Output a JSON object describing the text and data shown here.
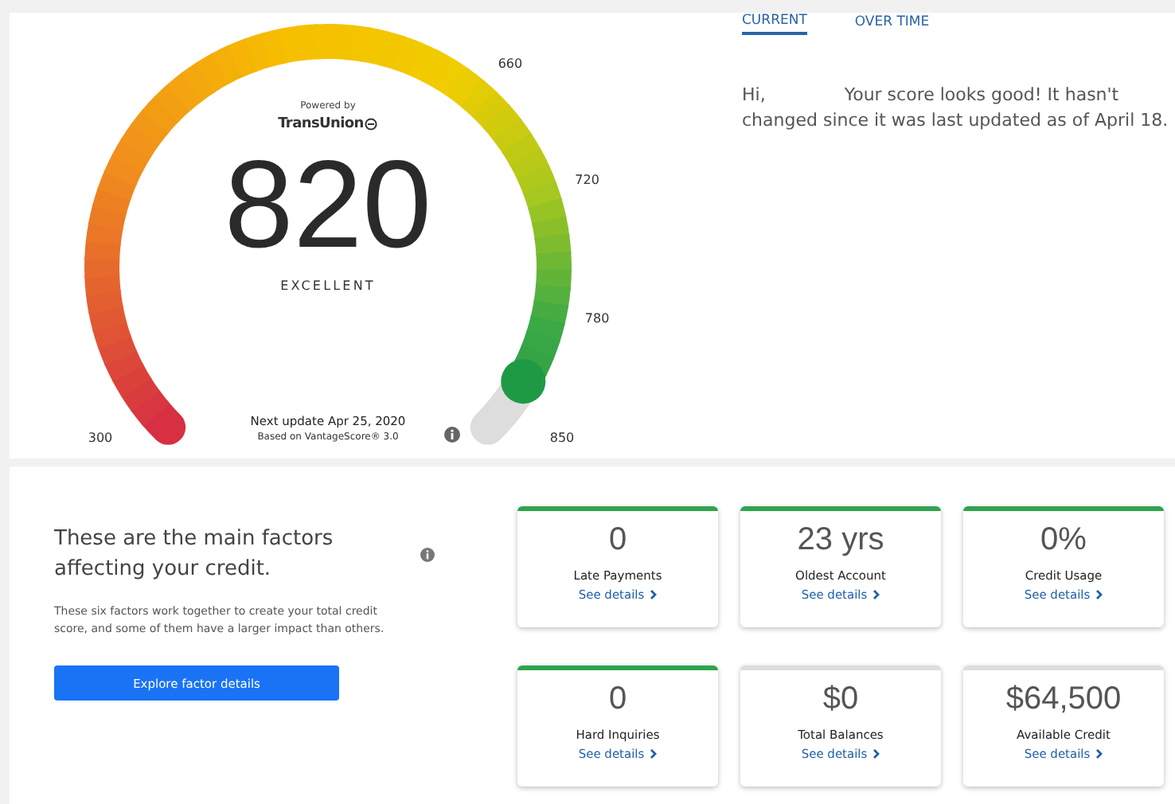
{
  "gauge": {
    "powered_by": "Powered by",
    "brand": "TransUnion",
    "score": "820",
    "rating": "EXCELLENT",
    "ticks": [
      "300",
      "660",
      "720",
      "780",
      "850"
    ],
    "next_update": "Next update Apr 25, 2020",
    "model": "Based on VantageScore® 3.0"
  },
  "tabs": [
    {
      "label": "CURRENT",
      "selected": true
    },
    {
      "label": "OVER TIME",
      "selected": false
    }
  ],
  "greeting": {
    "salutation": "Hi,",
    "message": "Your score looks good! It hasn't changed since it was last updated as of April 18."
  },
  "factors": {
    "heading": "These are the main factors affecting your credit.",
    "description": "These six factors work together to create your total credit score, and some of them have a larger impact than others.",
    "button": "Explore factor details"
  },
  "cards": [
    {
      "value": "0",
      "label": "Late Payments",
      "link": "See details",
      "highlighted": true
    },
    {
      "value": "23 yrs",
      "label": "Oldest Account",
      "link": "See details",
      "highlighted": true
    },
    {
      "value": "0%",
      "label": "Credit Usage",
      "link": "See details",
      "highlighted": true
    },
    {
      "value": "0",
      "label": "Hard Inquiries",
      "link": "See details",
      "highlighted": true
    },
    {
      "value": "$0",
      "label": "Total Balances",
      "link": "See details",
      "highlighted": false
    },
    {
      "value": "$64,500",
      "label": "Available Credit",
      "link": "See details",
      "highlighted": false
    }
  ]
}
